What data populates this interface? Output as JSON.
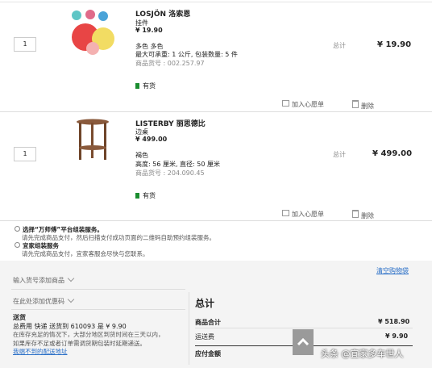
{
  "items": [
    {
      "name": "LOSJÖN 洛索恩",
      "type": "挂件",
      "price": "¥ 19.90",
      "qty": "1",
      "color": "多色 多色",
      "spec": "最大可承重: 1 公斤, 包装数量: 5 件",
      "article": "商品货号 : 002.257.97",
      "stock": "有货",
      "total_label": "总计",
      "total": "¥ 19.90",
      "wishlist": "加入心愿单",
      "remove": "删除"
    },
    {
      "name": "LISTERBY 丽思德比",
      "type": "边桌",
      "price": "¥ 499.00",
      "qty": "1",
      "color": "褐色",
      "spec": "高度: 56 厘米, 直径: 50 厘米",
      "article": "商品货号 : 204.090.45",
      "stock": "有货",
      "total_label": "总计",
      "total": "¥ 499.00",
      "wishlist": "加入心愿单",
      "remove": "删除"
    }
  ],
  "services": [
    {
      "title": "选择“万师傅”平台组装服务。",
      "desc": "请先完成商品支付，然后扫描支付成功页面的二维码自助预约组装服务。"
    },
    {
      "title": "宜家组装服务",
      "desc": "请先完成商品支付，宜家客服会尽快与您联系。"
    }
  ],
  "clear_cart": "清空购物袋",
  "add_by_article": "输入货号添加商品",
  "coupon": "在此处添加优惠码",
  "delivery": {
    "title": "送货",
    "line1": "总费用 快递 送货到 610093 是 ¥ 9.90",
    "line2": "在库存充足的情况下，大部分地区到货时间在三天以内，",
    "line3": "如果库存不足或者订单需调货期包装时延期递送。",
    "link": "我端不到的配送地址"
  },
  "summary": {
    "title": "总计",
    "subtotal_label": "商品合计",
    "subtotal": "¥ 518.90",
    "shipping_label": "运送费",
    "shipping": "¥ 9.90",
    "due_label": "应付金额"
  },
  "watermark": "头条 @宜家多车世人",
  "colors": {
    "stock": "#1a8d2f",
    "link": "#2a6fc7"
  }
}
